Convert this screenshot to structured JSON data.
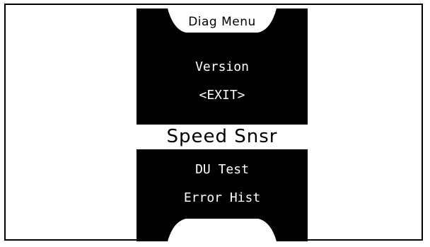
{
  "menu": {
    "title": "Diag Menu",
    "items_above": [
      "Version",
      "<EXIT>"
    ],
    "selected": "Speed Snsr",
    "items_below": [
      "DU Test",
      "Error Hist"
    ]
  },
  "colors": {
    "screen": "#000000",
    "text": "#ffffff",
    "highlight": "#ffffff",
    "border": "#000000"
  },
  "icons": {
    "top_tab": "title-tab-shape",
    "bottom_tab": "bottom-tab-shape"
  }
}
